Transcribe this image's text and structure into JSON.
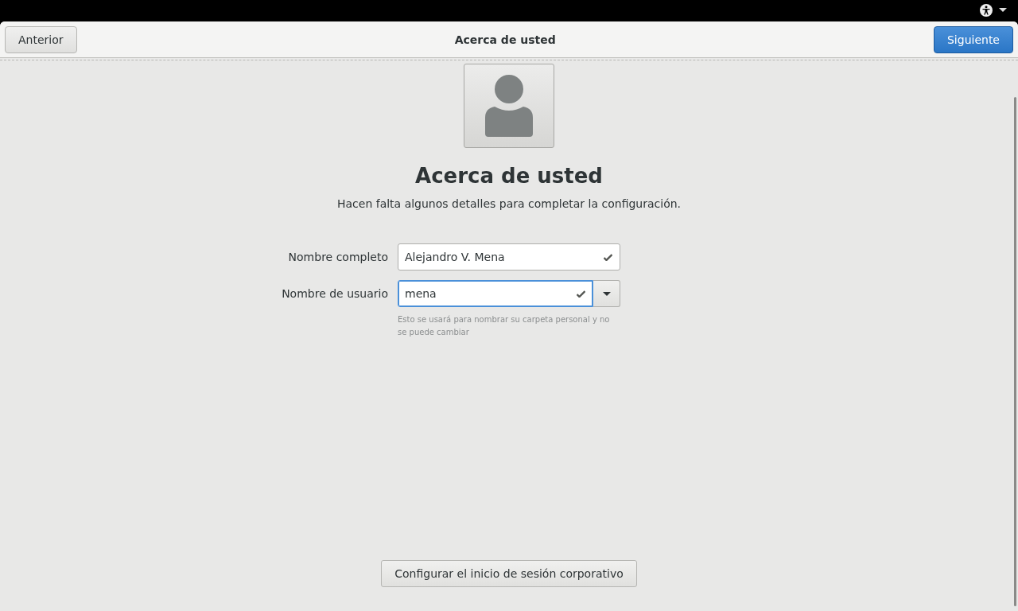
{
  "header": {
    "back_button": "Anterior",
    "title": "Acerca de usted",
    "next_button": "Siguiente"
  },
  "page": {
    "heading": "Acerca de usted",
    "subtitle": "Hacen falta algunos detalles para completar la configuración.",
    "fields": [
      {
        "kind": "entry",
        "label": "Nombre completo",
        "value": "Alejandro V. Mena",
        "valid": true,
        "focused": false
      },
      {
        "kind": "combo",
        "label": "Nombre de usuario",
        "value": "mena",
        "valid": true,
        "focused": true,
        "hint": "Esto se usará para nombrar su carpeta personal y no se puede cambiar"
      }
    ],
    "enterprise_button": "Configurar el inicio de sesión corporativo"
  }
}
